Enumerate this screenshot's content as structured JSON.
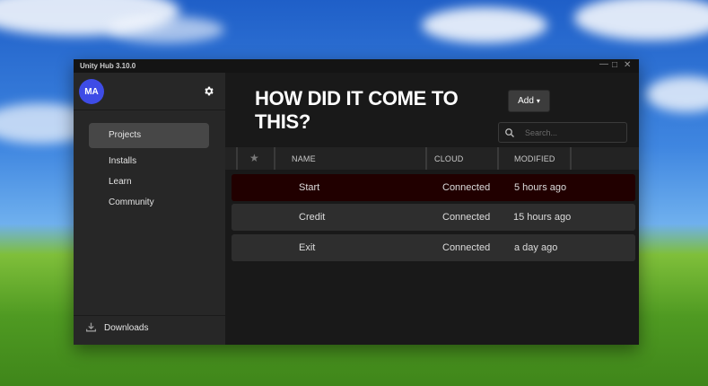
{
  "window": {
    "title": "Unity Hub 3.10.0",
    "controls": {
      "minimize": "—",
      "maximize": "□",
      "close": "✕"
    }
  },
  "sidebar": {
    "avatar_initials": "MA",
    "items": [
      {
        "label": "Projects",
        "active": true
      },
      {
        "label": "Installs"
      },
      {
        "label": "Learn"
      },
      {
        "label": "Community"
      }
    ],
    "downloads_label": "Downloads"
  },
  "main": {
    "heading": "HOW DID IT COME TO THIS?",
    "add_button_label": "Add",
    "add_button_caret": "▾",
    "search_placeholder": "Search...",
    "columns": {
      "star": "★",
      "name": "NAME",
      "cloud": "CLOUD",
      "modified": "MODIFIED"
    },
    "rows": [
      {
        "name": "Start",
        "cloud": "Connected",
        "modified": "5 hours ago",
        "highlighted": true
      },
      {
        "name": "Credit",
        "cloud": "Connected",
        "modified": "15 hours ago"
      },
      {
        "name": "Exit",
        "cloud": "Connected",
        "modified": "a day ago"
      }
    ]
  },
  "colors": {
    "accent_avatar": "#3e4ce6",
    "selected_row": "#210000",
    "window_bg": "#191919",
    "sidebar_bg": "#272727"
  }
}
